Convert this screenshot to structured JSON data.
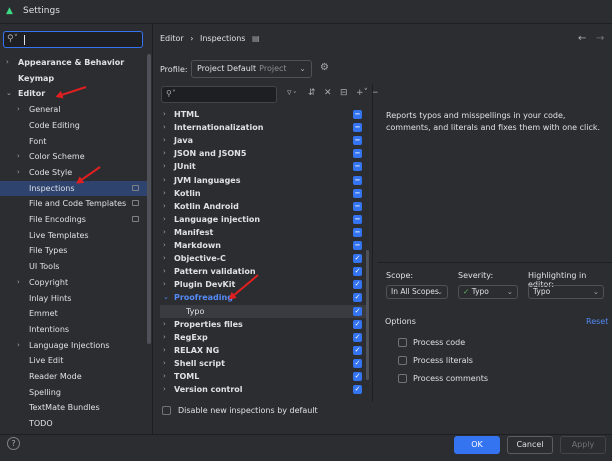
{
  "window": {
    "title": "Settings",
    "app_icon": "android-icon"
  },
  "search": {
    "value": ""
  },
  "sidebar": {
    "items": [
      {
        "label": "Appearance & Behavior",
        "expanded": false
      },
      {
        "label": "Keymap"
      },
      {
        "label": "Editor",
        "expanded": true
      },
      {
        "label": "General"
      },
      {
        "label": "Code Editing"
      },
      {
        "label": "Font"
      },
      {
        "label": "Color Scheme"
      },
      {
        "label": "Code Style"
      },
      {
        "label": "Inspections",
        "selected": true
      },
      {
        "label": "File and Code Templates"
      },
      {
        "label": "File Encodings"
      },
      {
        "label": "Live Templates"
      },
      {
        "label": "File Types"
      },
      {
        "label": "UI Tools"
      },
      {
        "label": "Copyright"
      },
      {
        "label": "Inlay Hints"
      },
      {
        "label": "Emmet"
      },
      {
        "label": "Intentions"
      },
      {
        "label": "Language Injections"
      },
      {
        "label": "Live Edit"
      },
      {
        "label": "Reader Mode"
      },
      {
        "label": "Spelling"
      },
      {
        "label": "TextMate Bundles"
      },
      {
        "label": "TODO"
      }
    ]
  },
  "breadcrumb": {
    "parent": "Editor",
    "separator": "›",
    "current": "Inspections"
  },
  "profile": {
    "label": "Profile:",
    "value": "Project Default",
    "scope": "Project"
  },
  "inspections": {
    "search_value": "",
    "items": [
      {
        "label": "HTML"
      },
      {
        "label": "Internationalization"
      },
      {
        "label": "Java"
      },
      {
        "label": "JSON and JSON5"
      },
      {
        "label": "JUnit"
      },
      {
        "label": "JVM languages"
      },
      {
        "label": "Kotlin"
      },
      {
        "label": "Kotlin Android"
      },
      {
        "label": "Language injection"
      },
      {
        "label": "Manifest"
      },
      {
        "label": "Markdown"
      },
      {
        "label": "Objective-C"
      },
      {
        "label": "Pattern validation"
      },
      {
        "label": "Plugin DevKit"
      },
      {
        "label": "Proofreading",
        "expanded": true,
        "highlighted": true
      },
      {
        "label": "Typo",
        "child": true
      },
      {
        "label": "Properties files"
      },
      {
        "label": "RegExp"
      },
      {
        "label": "RELAX NG"
      },
      {
        "label": "Shell script"
      },
      {
        "label": "TOML"
      },
      {
        "label": "Version control"
      }
    ],
    "states": [
      "partial",
      "partial",
      "partial",
      "partial",
      "partial",
      "partial",
      "partial",
      "partial",
      "partial",
      "partial",
      "partial",
      "checked",
      "checked",
      "checked",
      "checked",
      "checked",
      "checked",
      "checked",
      "checked",
      "checked",
      "checked",
      "checked"
    ],
    "disable_new_label": "Disable new inspections by default"
  },
  "description": "Reports typos and misspellings in your code, comments, and literals and fixes them with one click.",
  "scope": {
    "label": "Scope:",
    "value": "In All Scopes"
  },
  "severity": {
    "label": "Severity:",
    "value": "Typo"
  },
  "highlighting": {
    "label": "Highlighting in editor:",
    "value": "Typo"
  },
  "options": {
    "title": "Options",
    "reset": "Reset",
    "items": [
      {
        "label": "Process code",
        "checked": false
      },
      {
        "label": "Process literals",
        "checked": false
      },
      {
        "label": "Process comments",
        "checked": false
      }
    ]
  },
  "footer": {
    "help": "?",
    "ok": "OK",
    "cancel": "Cancel",
    "apply": "Apply"
  },
  "colors": {
    "accent": "#3574f0",
    "highlight_text": "#548af7",
    "background": "#2b2d30",
    "annotation_arrow": "#e02020"
  }
}
